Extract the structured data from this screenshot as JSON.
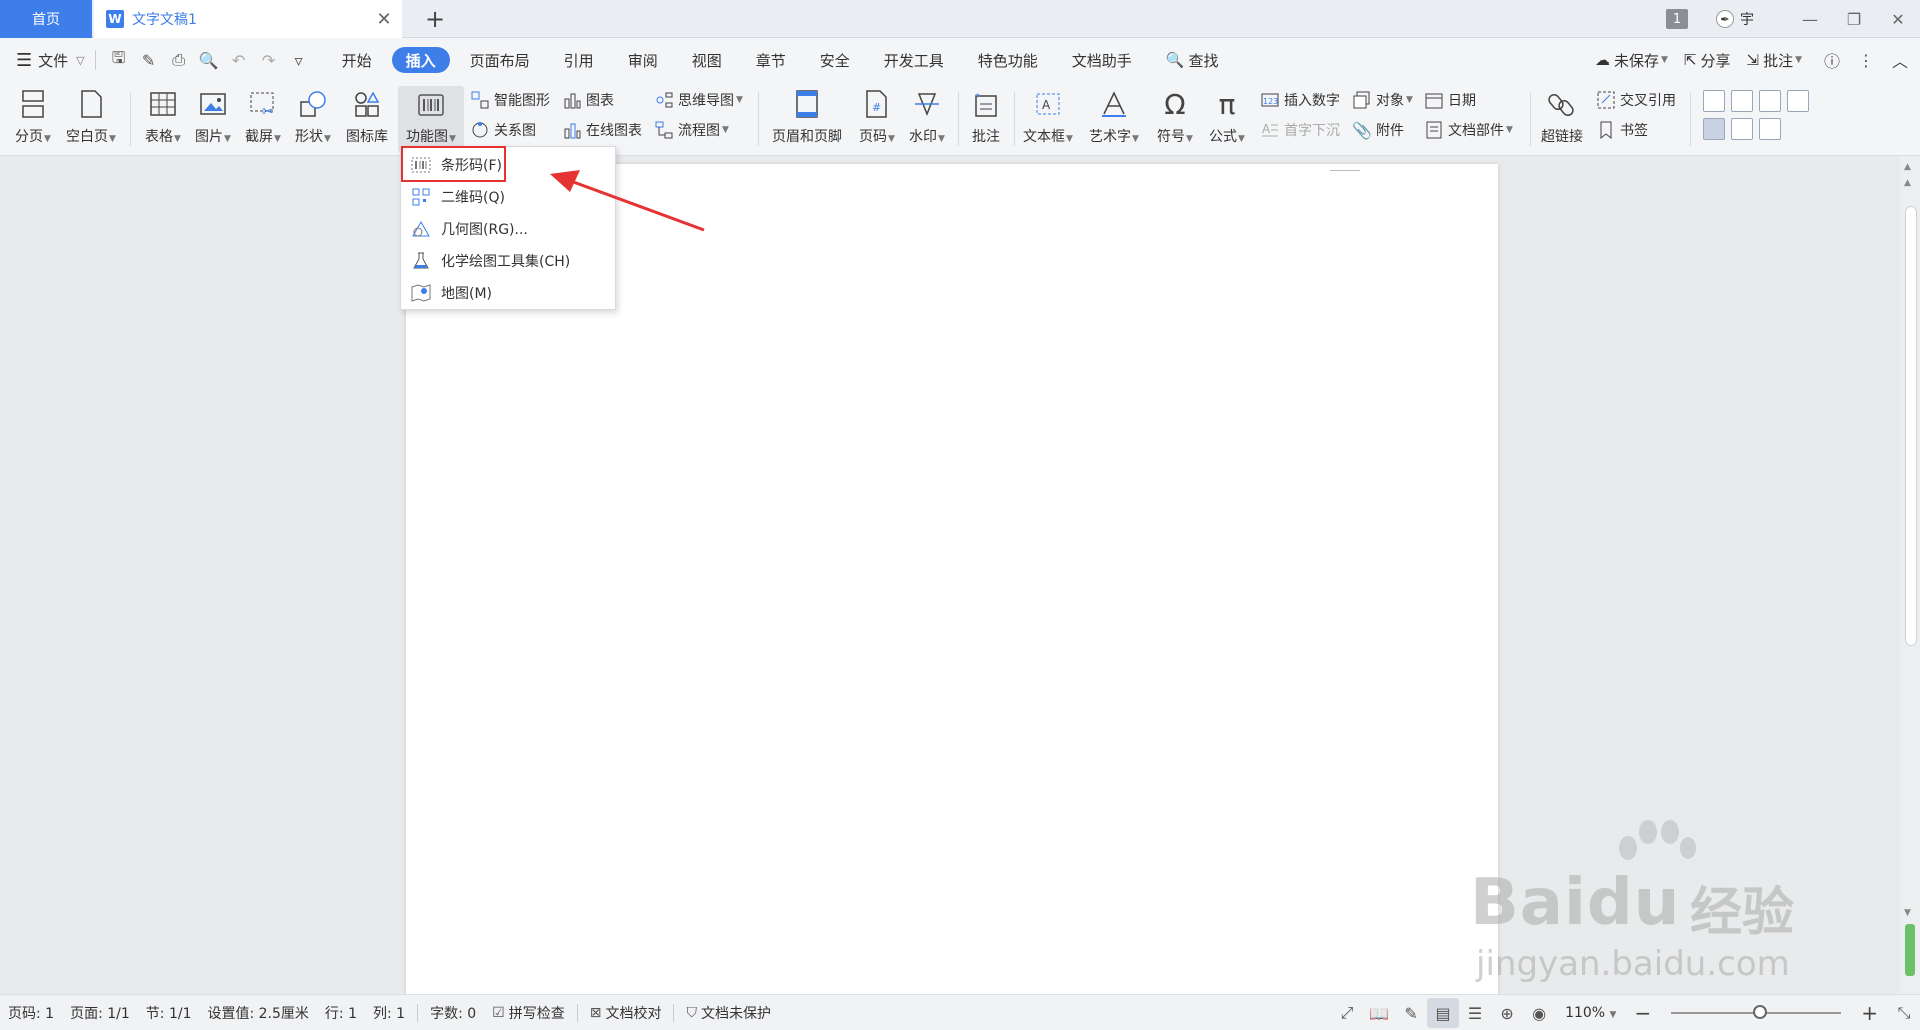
{
  "titlebar": {
    "home_tab": "首页",
    "doc_tab": "文字文稿1",
    "window_badge": "1",
    "user_name": "宇"
  },
  "menubar": {
    "file": "文件",
    "tabs": [
      "开始",
      "插入",
      "页面布局",
      "引用",
      "审阅",
      "视图",
      "章节",
      "安全",
      "开发工具",
      "特色功能",
      "文档助手",
      "查找"
    ],
    "active_tab": "插入",
    "right": {
      "unsaved": "未保存",
      "share": "分享",
      "comment": "批注"
    }
  },
  "ribbon": {
    "page_break": "分页",
    "blank_page": "空白页",
    "table": "表格",
    "picture": "图片",
    "screenshot": "截屏",
    "shapes": "形状",
    "icon_lib": "图标库",
    "func_chart": "功能图",
    "smart_art": "智能图形",
    "chart": "图表",
    "mind_map": "思维导图",
    "relation": "关系图",
    "online_chart": "在线图表",
    "flow_chart": "流程图",
    "header_footer": "页眉和页脚",
    "page_number": "页码",
    "watermark": "水印",
    "comment": "批注",
    "text_box": "文本框",
    "word_art": "艺术字",
    "symbol": "符号",
    "formula": "公式",
    "insert_number": "插入数字",
    "object": "对象",
    "date": "日期",
    "drop_cap": "首字下沉",
    "attachment": "附件",
    "doc_parts": "文档部件",
    "hyperlink": "超链接",
    "cross_ref": "交叉引用",
    "bookmark": "书签"
  },
  "dropdown": {
    "items": [
      "条形码(F)",
      "二维码(Q)",
      "几何图(RG)...",
      "化学绘图工具集(CH)",
      "地图(M)"
    ]
  },
  "statusbar": {
    "page_no": "页码: 1",
    "pages": "页面: 1/1",
    "section": "节: 1/1",
    "setting": "设置值: 2.5厘米",
    "row": "行: 1",
    "col": "列: 1",
    "words": "字数: 0",
    "spell": "拼写检查",
    "proof": "文档校对",
    "protect": "文档未保护",
    "zoom": "110%"
  },
  "watermark": {
    "brand": "Baidu",
    "cn": "经验",
    "url": "jingyan.baidu.com"
  },
  "colors": {
    "accent": "#3d7ee8",
    "highlight": "#e53232"
  }
}
